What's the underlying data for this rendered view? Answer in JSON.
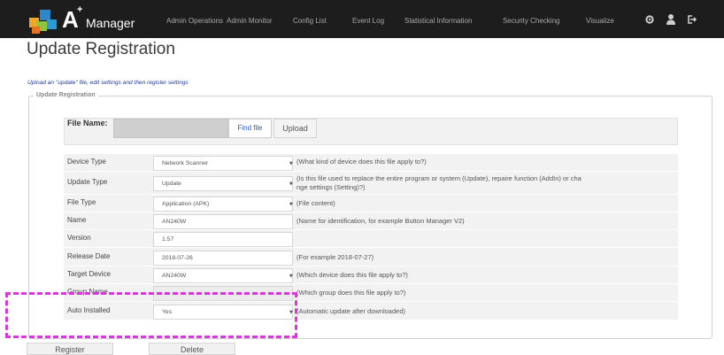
{
  "app": {
    "logo_letter": "A",
    "logo_plus": "+",
    "logo_word": "Manager"
  },
  "nav": {
    "items": [
      "Admin Operations",
      "Admin Monitor",
      "Config List",
      "Event Log",
      "Statistical Information",
      "Security Checking",
      "Visualize"
    ],
    "icons": [
      "gear-icon",
      "user-icon",
      "logout-icon"
    ]
  },
  "page": {
    "title": "Update Registration",
    "instructions": "Upload an \"update\" file, edit settings and then register settings",
    "legend": "Update Registration"
  },
  "file": {
    "label": "File Name:",
    "value": "",
    "find_label": "Find file",
    "upload_label": "Upload"
  },
  "form": {
    "rows": [
      {
        "label": "Device Type",
        "value": "Network Scanner",
        "kind": "select",
        "help": "(What kind of device does this file apply to?)"
      },
      {
        "label": "Update Type",
        "value": "Update",
        "kind": "select",
        "help": "(Is this file used to replace the entire program or system (Update), repaire function (AddIn) or cha",
        "help2": "nge settings (Setting)?)"
      },
      {
        "label": "File Type",
        "value": "Application (APK)",
        "kind": "select",
        "help": "(File content)"
      },
      {
        "label": "Name",
        "value": "AN240W",
        "kind": "text",
        "help": "(Name for identification, for example Button Manager V2)"
      },
      {
        "label": "Version",
        "value": "1.57",
        "kind": "text",
        "help": ""
      },
      {
        "label": "Release Date",
        "value": "2018-07-26",
        "kind": "text",
        "help": "(For example 2018-07-27)"
      },
      {
        "label": "Target Device",
        "value": "AN240W",
        "kind": "select",
        "help": "(Which device does this file apply to?)"
      },
      {
        "label": "Group Name",
        "value": "",
        "kind": "blank",
        "help": "(Which group does this file apply to?)"
      },
      {
        "label": "Auto Installed",
        "value": "Yes",
        "kind": "select",
        "help": "(Automatic update after downloaded)"
      }
    ]
  },
  "actions": {
    "register_label": "Register",
    "delete_label": "Delete"
  },
  "colors": {
    "topbar": "#1d1d1d",
    "highlight": "#e033e0",
    "link": "#2b5bb0",
    "instructions": "#1f3c9e"
  }
}
